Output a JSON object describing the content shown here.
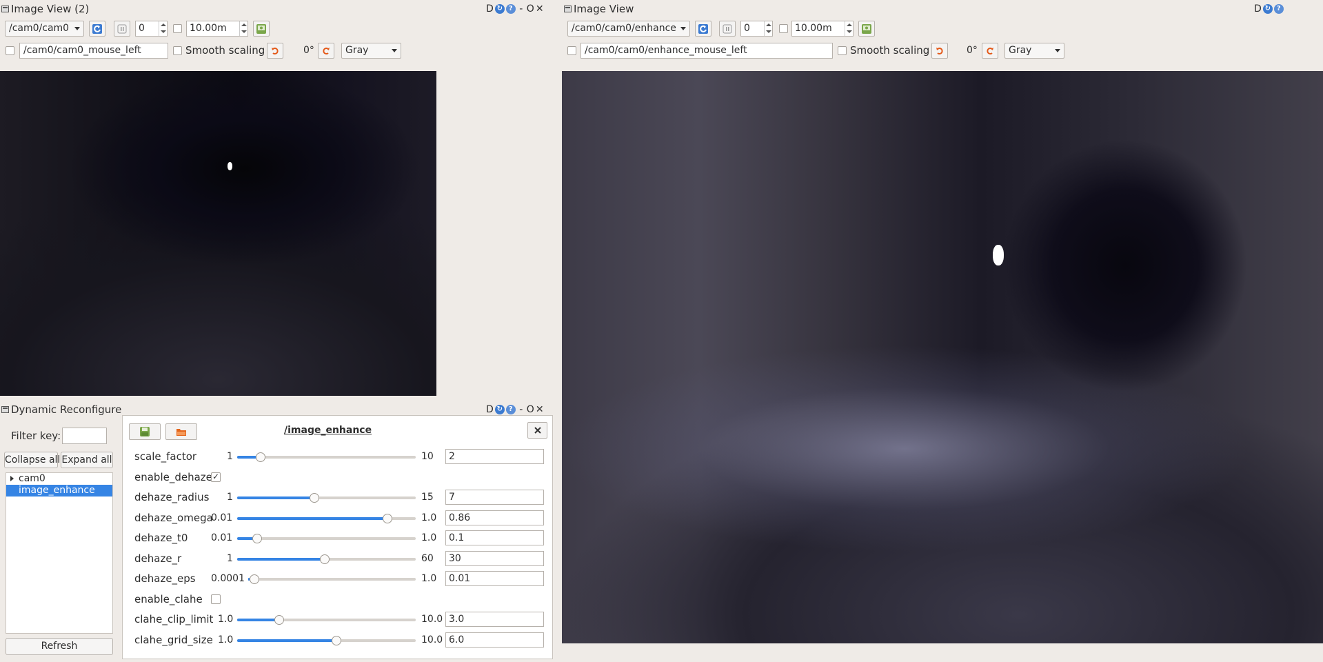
{
  "left_view": {
    "title": "Image View (2)",
    "ctrl_d": "D",
    "ctrl_o": "O",
    "topic": "/cam0/cam0",
    "spin_value": "0",
    "distance": "10.00m",
    "mouse_topic": "/cam0/cam0_mouse_left",
    "smooth_label": "Smooth scaling",
    "rotation": "0°",
    "colormap": "Gray"
  },
  "right_view": {
    "title": "Image View",
    "ctrl_d": "D",
    "topic": "/cam0/cam0/enhance",
    "spin_value": "0",
    "distance": "10.00m",
    "mouse_topic": "/cam0/cam0/enhance_mouse_left",
    "smooth_label": "Smooth scaling",
    "rotation": "0°",
    "colormap": "Gray"
  },
  "reconfigure": {
    "title": "Dynamic Reconfigure",
    "ctrl_d": "D",
    "ctrl_o": "O",
    "filter_label": "Filter key:",
    "filter_value": "",
    "collapse_label": "Collapse all",
    "expand_label": "Expand all",
    "tree": [
      {
        "label": "cam0"
      },
      {
        "label": "image_enhance"
      }
    ],
    "refresh_label": "Refresh",
    "node_name": "/image_enhance",
    "params": [
      {
        "name": "scale_factor",
        "min": "1",
        "max": "10",
        "value": "2",
        "fraction": 0.11
      },
      {
        "name": "enable_dehaze",
        "checked": "✓"
      },
      {
        "name": "dehaze_radius",
        "min": "1",
        "max": "15",
        "value": "7",
        "fraction": 0.43
      },
      {
        "name": "dehaze_omega",
        "min": "0.01",
        "max": "1.0",
        "value": "0.86",
        "fraction": 0.86
      },
      {
        "name": "dehaze_t0",
        "min": "0.01",
        "max": "1.0",
        "value": "0.1",
        "fraction": 0.09
      },
      {
        "name": "dehaze_r",
        "min": "1",
        "max": "60",
        "value": "30",
        "fraction": 0.49
      },
      {
        "name": "dehaze_eps",
        "min": "0.0001",
        "max": "1.0",
        "value": "0.01",
        "fraction": 0.01
      },
      {
        "name": "enable_clahe",
        "checked": ""
      },
      {
        "name": "clahe_clip_limit",
        "min": "1.0",
        "max": "10.0",
        "value": "3.0",
        "fraction": 0.22
      },
      {
        "name": "clahe_grid_size",
        "min": "1.0",
        "max": "10.0",
        "value": "6.0",
        "fraction": 0.56
      }
    ]
  },
  "colors": {
    "window_bg": "#efebe7",
    "selection": "#3584e4",
    "slider_fill": "#3584e4"
  }
}
